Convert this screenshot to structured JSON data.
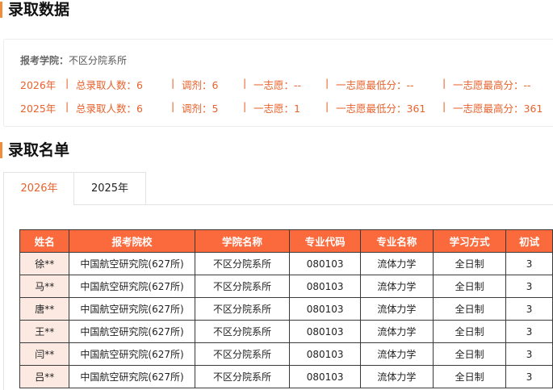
{
  "sections": {
    "data_title": "录取数据",
    "list_title": "录取名单"
  },
  "stats": {
    "school_label": "报考学院：",
    "school_value": "不区分院系所",
    "years": [
      {
        "year": "2026年",
        "total_label": "总录取人数：",
        "total": "6",
        "adjust_label": "调剂：",
        "adjust": "6",
        "first_label": "一志愿：",
        "first": "--",
        "min_label": "一志愿最低分：",
        "min": "--",
        "max_label": "一志愿最高分：",
        "max": "--"
      },
      {
        "year": "2025年",
        "total_label": "总录取人数：",
        "total": "6",
        "adjust_label": "调剂：",
        "adjust": "5",
        "first_label": "一志愿：",
        "first": "1",
        "min_label": "一志愿最低分：",
        "min": "361",
        "max_label": "一志愿最高分：",
        "max": "361"
      }
    ]
  },
  "tabs": [
    {
      "label": "2026年",
      "active": true
    },
    {
      "label": "2025年",
      "active": false
    }
  ],
  "table": {
    "headers": [
      "姓名",
      "报考院校",
      "学院名称",
      "专业代码",
      "专业名称",
      "学习方式",
      "初试"
    ],
    "rows": [
      {
        "name": "徐**",
        "school": "中国航空研究院(627所)",
        "college": "不区分院系所",
        "code": "080103",
        "major": "流体力学",
        "mode": "全日制",
        "score": "3"
      },
      {
        "name": "马**",
        "school": "中国航空研究院(627所)",
        "college": "不区分院系所",
        "code": "080103",
        "major": "流体力学",
        "mode": "全日制",
        "score": "3"
      },
      {
        "name": "唐**",
        "school": "中国航空研究院(627所)",
        "college": "不区分院系所",
        "code": "080103",
        "major": "流体力学",
        "mode": "全日制",
        "score": "3"
      },
      {
        "name": "王**",
        "school": "中国航空研究院(627所)",
        "college": "不区分院系所",
        "code": "080103",
        "major": "流体力学",
        "mode": "全日制",
        "score": "3"
      },
      {
        "name": "闫**",
        "school": "中国航空研究院(627所)",
        "college": "不区分院系所",
        "code": "080103",
        "major": "流体力学",
        "mode": "全日制",
        "score": "3"
      },
      {
        "name": "吕**",
        "school": "中国航空研究院(627所)",
        "college": "不区分院系所",
        "code": "080103",
        "major": "流体力学",
        "mode": "全日制",
        "score": "3"
      }
    ]
  },
  "colors": {
    "accent": "#e8622c",
    "header_bg": "#fb6a3c",
    "name_cell_bg": "#fbe9e2",
    "title_bar": "#f08c3a"
  }
}
